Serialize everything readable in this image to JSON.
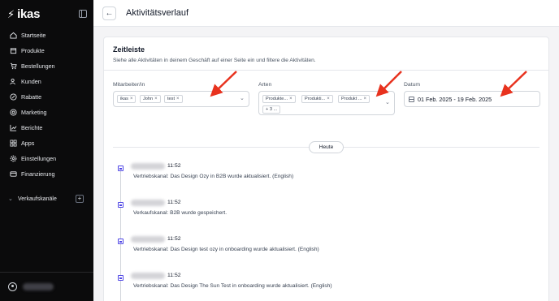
{
  "brand": {
    "name": "ikas"
  },
  "sidebar": {
    "items": [
      {
        "label": "Startseite",
        "icon": "home-icon"
      },
      {
        "label": "Produkte",
        "icon": "box-icon"
      },
      {
        "label": "Bestellungen",
        "icon": "cart-icon"
      },
      {
        "label": "Kunden",
        "icon": "users-icon"
      },
      {
        "label": "Rabatte",
        "icon": "discount-icon"
      },
      {
        "label": "Marketing",
        "icon": "target-icon"
      },
      {
        "label": "Berichte",
        "icon": "chart-icon"
      },
      {
        "label": "Apps",
        "icon": "apps-icon"
      },
      {
        "label": "Einstellungen",
        "icon": "gear-icon"
      },
      {
        "label": "Finanzierung",
        "icon": "finance-icon"
      }
    ],
    "sales_channels_label": "Verkaufskanäle",
    "add_symbol": "+"
  },
  "header": {
    "title": "Aktivitätsverlauf",
    "back_symbol": "←"
  },
  "card": {
    "title": "Zeitleiste",
    "subtitle": "Siehe alle Aktivitäten in deinem Geschäft auf einer Seite ein und filtere die Aktivitäten."
  },
  "filters": {
    "staff": {
      "label": "Mitarbeiter/in",
      "chips": [
        "ikas",
        "John",
        "test"
      ]
    },
    "types": {
      "label": "Arten",
      "chips": [
        "Produkte...",
        "Produkti...",
        "Produkt ...",
        "+ 3 ..."
      ]
    },
    "date": {
      "label": "Datum",
      "value": "01 Feb. 2025 - 19 Feb. 2025"
    }
  },
  "divider_label": "Heute",
  "activities": [
    {
      "time": "11:52",
      "text": "Vertriebskanal: Das Design Ozy in B2B wurde aktualisiert. (English)"
    },
    {
      "time": "11:52",
      "text": "Verkaufskanal: B2B wurde gespeichert."
    },
    {
      "time": "11:52",
      "text": "Vertriebskanal: Das Design test ozy in onboarding wurde aktualisiert. (English)"
    },
    {
      "time": "11:52",
      "text": "Vertriebskanal: Das Design The Sun Test in onboarding wurde aktualisiert. (English)"
    }
  ],
  "colors": {
    "sidebar_bg": "#0b0b0c",
    "accent": "#4f46e5",
    "annotation_arrow": "#e8321e"
  }
}
